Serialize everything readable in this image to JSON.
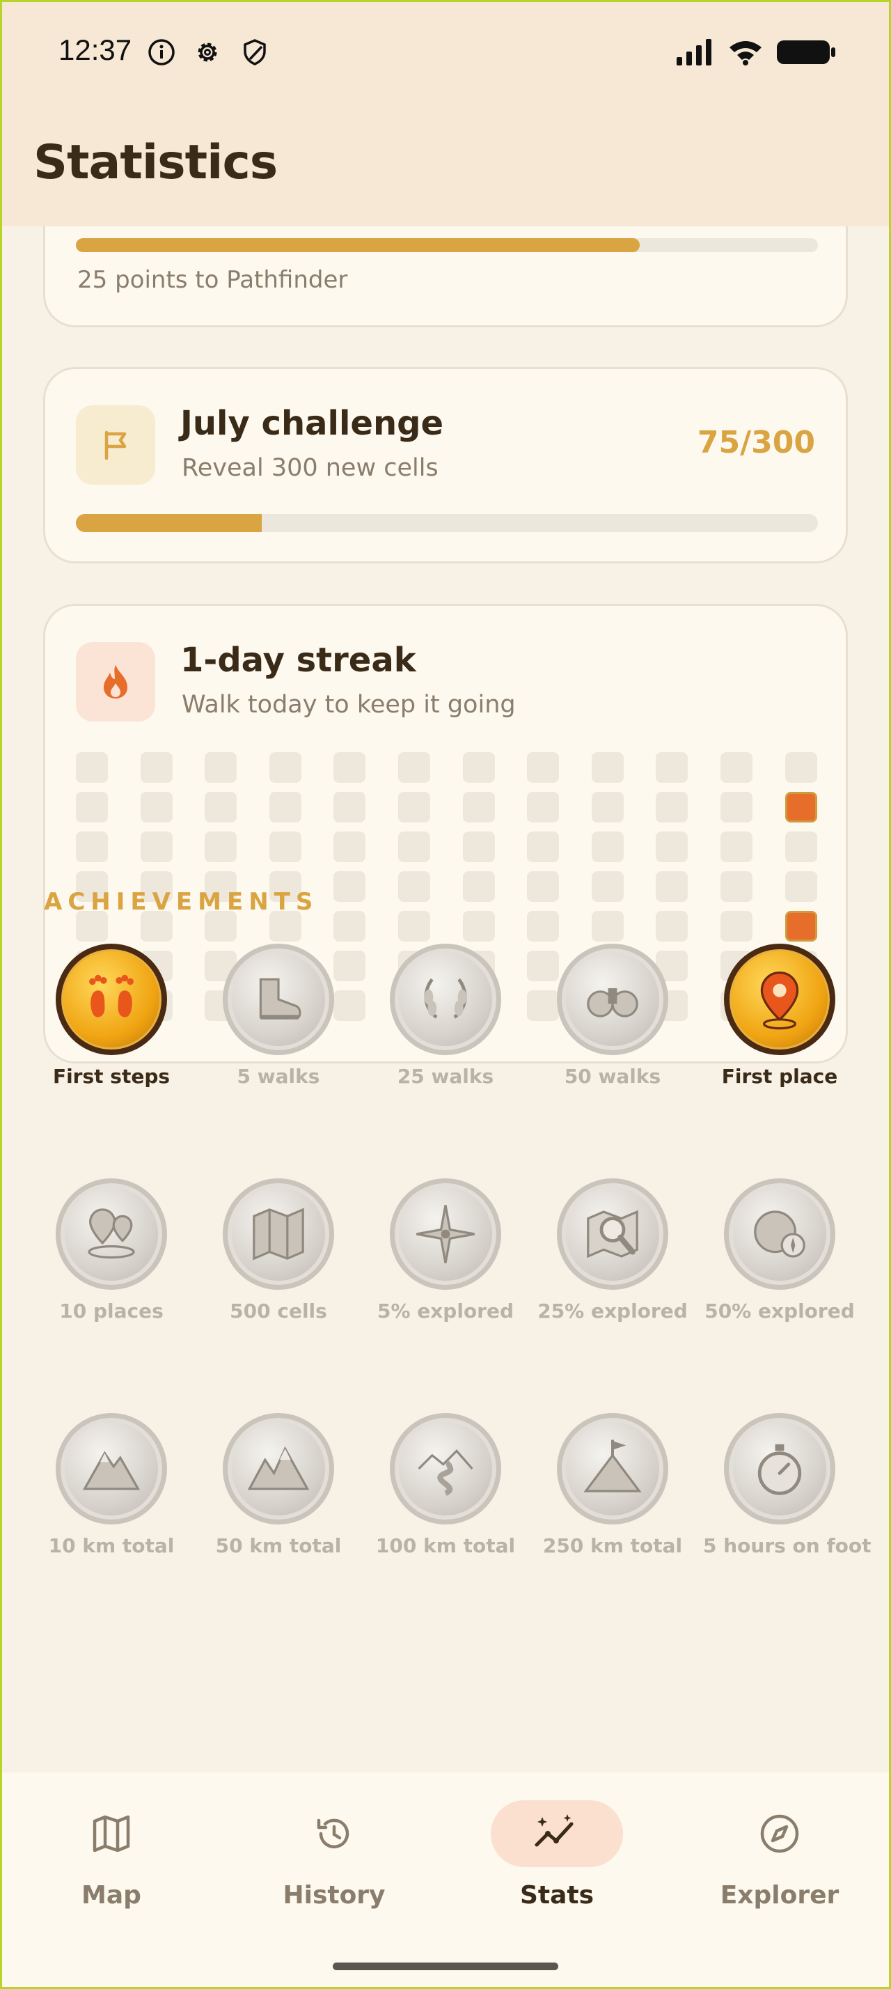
{
  "status_bar": {
    "time": "12:37",
    "left_icons": [
      "info-icon",
      "gear-icon",
      "shield-icon"
    ],
    "right_icons": [
      "signal-icon",
      "wifi-icon",
      "battery-icon"
    ]
  },
  "header": {
    "title": "Statistics"
  },
  "rank_card": {
    "progress": 0.76,
    "caption": "25 points to Pathfinder"
  },
  "challenge_card": {
    "icon": "flag-icon",
    "title": "July challenge",
    "subtitle": "Reveal 300 new cells",
    "count": "75/300",
    "progress": 0.25
  },
  "streak_card": {
    "icon": "flame-icon",
    "title": "1-day streak",
    "subtitle": "Walk today to keep it going",
    "columns": 12,
    "rows": 7,
    "last_column_rows": 6,
    "active_cells": [
      [
        11,
        1
      ],
      [
        11,
        4
      ]
    ]
  },
  "achievements": {
    "section_title": "ACHIEVEMENTS",
    "items": [
      {
        "label": "First steps",
        "unlocked": true,
        "icon": "footprints-icon"
      },
      {
        "label": "5 walks",
        "unlocked": false,
        "icon": "boot-icon"
      },
      {
        "label": "25 walks",
        "unlocked": false,
        "icon": "laurel-icon"
      },
      {
        "label": "50 walks",
        "unlocked": false,
        "icon": "binoculars-icon"
      },
      {
        "label": "First place",
        "unlocked": true,
        "icon": "map-pin-icon"
      },
      {
        "label": "10 places",
        "unlocked": false,
        "icon": "pins-icon"
      },
      {
        "label": "500 cells",
        "unlocked": false,
        "icon": "folded-map-icon"
      },
      {
        "label": "5% explored",
        "unlocked": false,
        "icon": "compass-rose-icon"
      },
      {
        "label": "25% explored",
        "unlocked": false,
        "icon": "magnifier-map-icon"
      },
      {
        "label": "50% explored",
        "unlocked": false,
        "icon": "globe-compass-icon"
      },
      {
        "label": "10 km total",
        "unlocked": false,
        "icon": "mountain-icon"
      },
      {
        "label": "50 km total",
        "unlocked": false,
        "icon": "mountains-icon"
      },
      {
        "label": "100 km total",
        "unlocked": false,
        "icon": "winding-road-icon"
      },
      {
        "label": "250 km total",
        "unlocked": false,
        "icon": "summit-flag-icon"
      },
      {
        "label": "5 hours on foot",
        "unlocked": false,
        "icon": "stopwatch-icon"
      }
    ]
  },
  "nav": {
    "items": [
      {
        "label": "Map",
        "icon": "map-icon",
        "active": false
      },
      {
        "label": "History",
        "icon": "history-icon",
        "active": false
      },
      {
        "label": "Stats",
        "icon": "stats-icon",
        "active": true
      },
      {
        "label": "Explorer",
        "icon": "compass-icon",
        "active": false
      }
    ]
  },
  "colors": {
    "background": "#f8f1e5",
    "header": "#f6e8d5",
    "accent": "#d9a441",
    "streak": "#e66d2a"
  }
}
